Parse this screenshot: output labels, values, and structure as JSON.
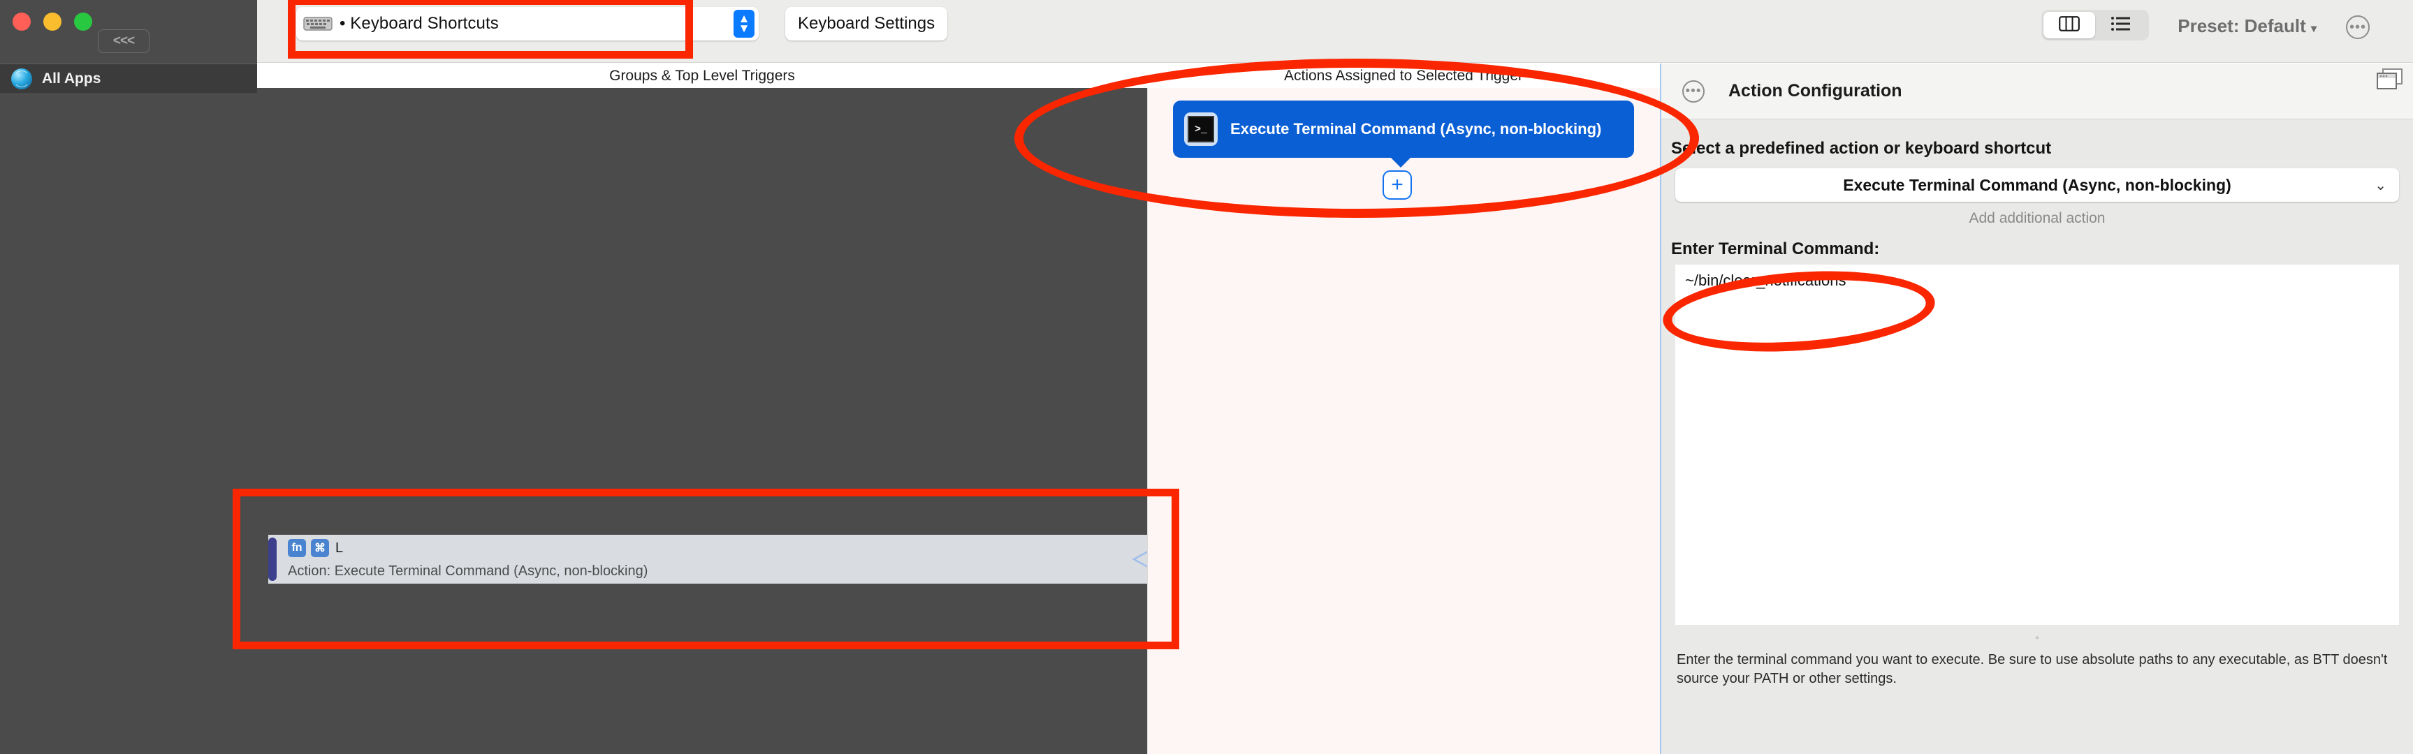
{
  "window": {
    "traffic_lights": [
      "close",
      "minimize",
      "zoom"
    ],
    "collapse_label": "<<<"
  },
  "toolbar": {
    "trigger_type_select": {
      "icon": "keyboard-icon",
      "value": "• Keyboard Shortcuts"
    },
    "keyboard_settings_button": "Keyboard Settings",
    "view_modes": [
      {
        "name": "columns-view",
        "active": true
      },
      {
        "name": "list-view",
        "active": false
      }
    ],
    "preset_label": "Preset: Default",
    "preset_caret": "▾",
    "more_button": "•••"
  },
  "columns": {
    "groups_header": "Groups & Top Level Triggers",
    "actions_header": "Actions Assigned to Selected Trigger"
  },
  "sidebar": {
    "items": [
      {
        "icon": "globe-icon",
        "label": "All Apps",
        "selected": true
      }
    ]
  },
  "triggers": {
    "selected_row": {
      "keys": [
        "fn",
        "⌘"
      ],
      "plain_key": "L",
      "subtitle": "Action: Execute Terminal Command (Async, non-blocking)"
    }
  },
  "actions": {
    "card": {
      "icon": "terminal-icon",
      "icon_glyph": ">_",
      "label": "Execute Terminal Command (Async, non-blocking)"
    },
    "add_button": "+"
  },
  "config": {
    "header_icon": "ellipsis-circle-icon",
    "header_title": "Action Configuration",
    "window_icon": "windows-icon",
    "section_label": "Select a predefined action or keyboard shortcut",
    "action_select": {
      "value": "Execute Terminal Command (Async, non-blocking)",
      "chevron": "⌄"
    },
    "add_additional_action": "Add additional action",
    "command_label": "Enter Terminal Command:",
    "command_value": "~/bin/clear_notifications",
    "resize_handle": "◦",
    "help_text": "Enter the terminal command you want to execute. Be sure to use absolute paths to any executable, as BTT doesn't source your PATH or other settings."
  },
  "annotations": {
    "color": "#fa2600",
    "shapes": [
      {
        "name": "rect-around-trigger-type-select",
        "type": "rect"
      },
      {
        "name": "ellipse-around-action-card",
        "type": "ellipse"
      },
      {
        "name": "ellipse-around-terminal-command",
        "type": "ellipse"
      },
      {
        "name": "rect-around-selected-trigger-row",
        "type": "rect"
      }
    ]
  }
}
